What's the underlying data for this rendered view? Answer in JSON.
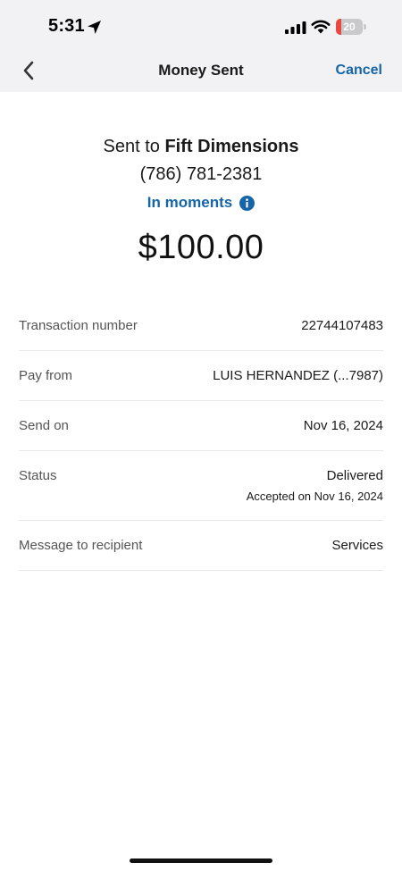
{
  "status_bar": {
    "time": "5:31",
    "battery_level": "20",
    "icons": [
      "location-arrow-icon",
      "cellular-signal-icon",
      "wifi-icon",
      "battery-icon"
    ]
  },
  "nav": {
    "back_icon": "chevron-left-icon",
    "title": "Money Sent",
    "cancel_label": "Cancel"
  },
  "summary": {
    "sent_prefix": "Sent to",
    "recipient_name": "Fift Dimensions",
    "recipient_phone": "(786) 781-2381",
    "timing": "In moments",
    "timing_icon": "info-icon",
    "amount": "$100.00"
  },
  "details": {
    "transaction": {
      "label": "Transaction number",
      "value": "22744107483"
    },
    "pay_from": {
      "label": "Pay from",
      "value": "LUIS HERNANDEZ (...7987)"
    },
    "send_on": {
      "label": "Send on",
      "value": "Nov 16, 2024"
    },
    "status": {
      "label": "Status",
      "value": "Delivered",
      "sub": "Accepted on Nov 16, 2024"
    },
    "message": {
      "label": "Message to recipient",
      "value": "Services"
    }
  },
  "colors": {
    "accent": "#1565a8",
    "header_background": "#f2f2f4",
    "battery_low": "#e8493f"
  }
}
